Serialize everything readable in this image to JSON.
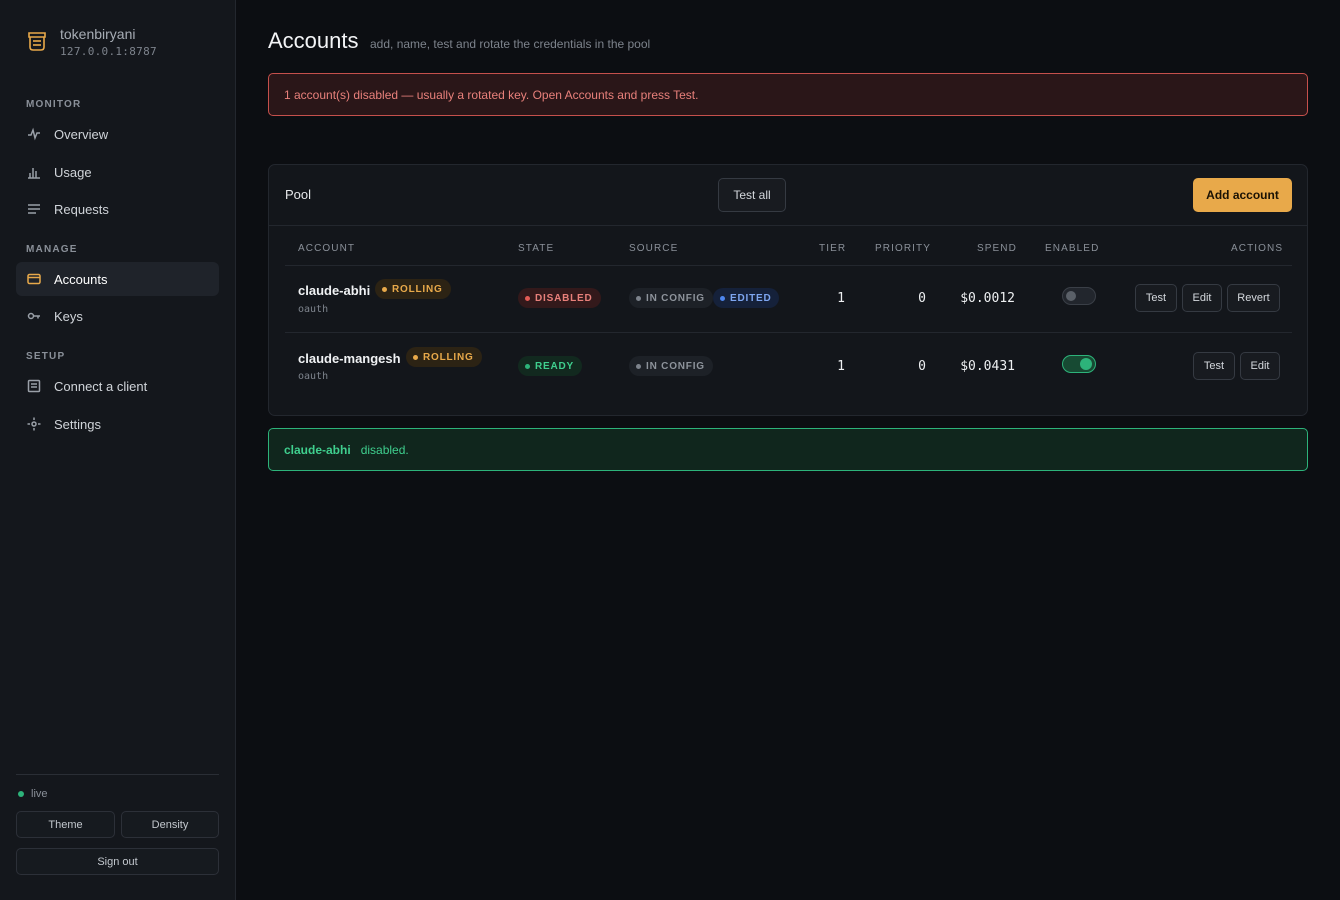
{
  "brand": {
    "name": "tokenbiryani",
    "host": "127.0.0.1:8787"
  },
  "sidebar": {
    "sections": [
      {
        "label": "MONITOR"
      },
      {
        "label": "MANAGE"
      },
      {
        "label": "SETUP"
      }
    ],
    "items": [
      {
        "label": "Overview",
        "icon": "activity-icon"
      },
      {
        "label": "Usage",
        "icon": "bar-chart-icon"
      },
      {
        "label": "Requests",
        "icon": "list-icon"
      },
      {
        "label": "Accounts",
        "icon": "card-icon",
        "active": true
      },
      {
        "label": "Keys",
        "icon": "key-icon"
      },
      {
        "label": "Connect a client",
        "icon": "plug-icon"
      },
      {
        "label": "Settings",
        "icon": "settings-icon"
      }
    ],
    "status": "live",
    "theme_label": "Theme",
    "density_label": "Density",
    "signout_label": "Sign out"
  },
  "page": {
    "title": "Accounts",
    "subtitle": "add, name, test and rotate the credentials in the pool"
  },
  "alert": {
    "text": "1 account(s) disabled — usually a rotated key. Open Accounts and press Test."
  },
  "pool": {
    "title": "Pool",
    "test_all_label": "Test all",
    "add_account_label": "Add account",
    "columns": [
      "ACCOUNT",
      "STATE",
      "SOURCE",
      "TIER",
      "PRIORITY",
      "SPEND",
      "ENABLED",
      "ACTIONS"
    ],
    "rows": [
      {
        "name": "claude-abhi",
        "badge": "ROLLING",
        "auth": "oauth",
        "state": "DISABLED",
        "sources": [
          "IN CONFIG",
          "EDITED"
        ],
        "tier": "1",
        "priority": "0",
        "spend": "$0.0012",
        "enabled": false,
        "actions": [
          "Test",
          "Edit",
          "Revert"
        ]
      },
      {
        "name": "claude-mangesh",
        "badge": "ROLLING",
        "auth": "oauth",
        "state": "READY",
        "sources": [
          "IN CONFIG"
        ],
        "tier": "1",
        "priority": "0",
        "spend": "$0.0431",
        "enabled": true,
        "actions": [
          "Test",
          "Edit"
        ]
      }
    ]
  },
  "toast": {
    "name": "claude-abhi",
    "message": "disabled."
  },
  "colors": {
    "accent": "#e8a94a",
    "danger": "#e25b55",
    "success": "#2db37a",
    "info": "#4d86ee",
    "background": "#0c0e12"
  }
}
